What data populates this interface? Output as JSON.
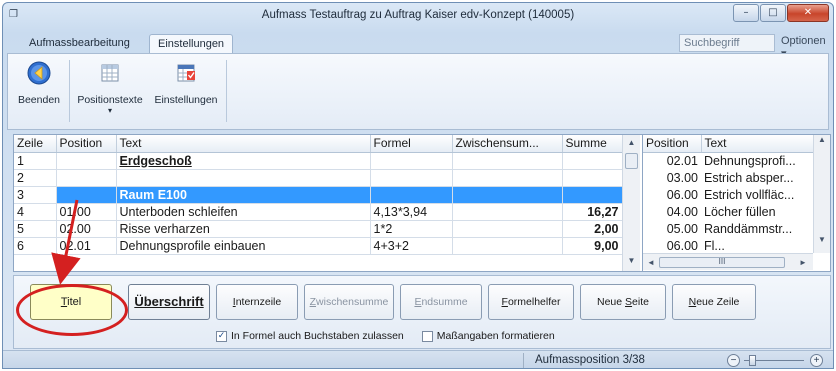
{
  "window": {
    "title": "Aufmass Testauftrag zu Auftrag Kaiser edv-Konzept (140005)",
    "controls": {
      "minimize": "–",
      "maximize": "□",
      "close": "✕"
    }
  },
  "tabs": [
    {
      "label": "Aufmassbearbeitung"
    },
    {
      "label": "Einstellungen"
    }
  ],
  "search": {
    "placeholder": "Suchbegriff"
  },
  "options_label": "Optionen ▾",
  "ribbon": {
    "buttons": [
      {
        "label": "Beenden",
        "icon": "back-arrow-icon"
      },
      {
        "label": "Positionstexte",
        "icon": "table-icon"
      },
      {
        "label": "Einstellungen",
        "icon": "settings-table-icon"
      }
    ],
    "dropdown_glyph": "▾"
  },
  "grid": {
    "columns": [
      "Zeile",
      "Position",
      "Text",
      "Formel",
      "Zwischensum...",
      "Summe"
    ],
    "rows": [
      {
        "zeile": "1",
        "position": "",
        "text": "Erdgeschoß",
        "formel": "",
        "zwischensumme": "",
        "summe": ""
      },
      {
        "zeile": "2",
        "position": "",
        "text": "",
        "formel": "",
        "zwischensumme": "",
        "summe": ""
      },
      {
        "zeile": "3",
        "position": "",
        "text": "Raum E100",
        "formel": "",
        "zwischensumme": "",
        "summe": ""
      },
      {
        "zeile": "4",
        "position": "01.00",
        "text": "Unterboden schleifen",
        "formel": "4,13*3,94",
        "zwischensumme": "",
        "summe": "16,27"
      },
      {
        "zeile": "5",
        "position": "02.00",
        "text": "Risse verharzen",
        "formel": "1*2",
        "zwischensumme": "",
        "summe": "2,00"
      },
      {
        "zeile": "6",
        "position": "02.01",
        "text": "Dehnungsprofile einbauen",
        "formel": "4+3+2",
        "zwischensumme": "",
        "summe": "9,00"
      }
    ],
    "scroll_up": "▲",
    "scroll_down": "▼"
  },
  "position_list": {
    "columns": [
      "Position",
      "Text"
    ],
    "rows": [
      {
        "position": "02.01",
        "text": "Dehnungsprofi..."
      },
      {
        "position": "03.00",
        "text": "Estrich absper..."
      },
      {
        "position": "06.00",
        "text": "Estrich vollfläc..."
      },
      {
        "position": "04.00",
        "text": "Löcher füllen"
      },
      {
        "position": "05.00",
        "text": "Randdämmstr..."
      },
      {
        "position": "06.00",
        "text": "Fl..."
      }
    ],
    "scroll_left": "◄",
    "scroll_right": "►",
    "thumb_grip": "III"
  },
  "actions": {
    "titel": {
      "accel": "T",
      "rest": "itel"
    },
    "ueberschrift": "Überschrift",
    "internzeile": {
      "accel": "I",
      "rest": "nternzeile"
    },
    "zwischensumme": {
      "accel": "Z",
      "rest": "wischensumme"
    },
    "endsumme": {
      "accel": "E",
      "rest": "ndsumme"
    },
    "formelhelfer": {
      "accel": "F",
      "rest": "ormelhelfer"
    },
    "neue_seite": {
      "pre": "Neue ",
      "accel": "S",
      "rest": "eite"
    },
    "neue_zeile": {
      "pre": "",
      "accel": "N",
      "rest": "eue Zeile"
    }
  },
  "options": {
    "buchstaben": {
      "label": "In Formel auch Buchstaben zulassen",
      "checked": true,
      "mark": "✓"
    },
    "massangaben": {
      "label": "Maßangaben formatieren",
      "checked": false,
      "mark": ""
    }
  },
  "status": {
    "text": "Aufmassposition 3/38",
    "zoom_minus": "−",
    "zoom_plus": "+"
  },
  "annotation_color": "#d42020",
  "selection_color": "#3399ff"
}
